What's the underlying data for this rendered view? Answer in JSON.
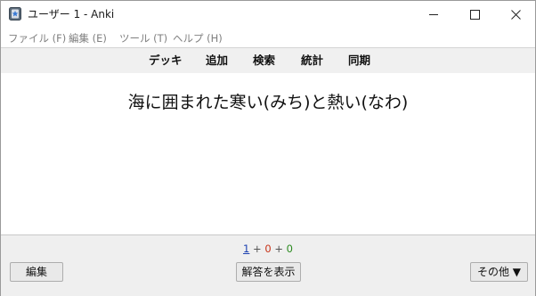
{
  "window": {
    "title": "ユーザー 1 - Anki",
    "icon": "anki-app-icon",
    "controls": [
      "minimize-icon",
      "maximize-icon",
      "close-icon"
    ]
  },
  "menu": {
    "items": [
      {
        "label": "ファイル (F)"
      },
      {
        "label": "編集 (E)"
      },
      {
        "label": "ツール (T)"
      },
      {
        "label": "ヘルプ (H)"
      }
    ]
  },
  "toolbar": {
    "items": [
      {
        "label": "デッキ"
      },
      {
        "label": "追加"
      },
      {
        "label": "検索"
      },
      {
        "label": "統計"
      },
      {
        "label": "同期"
      }
    ]
  },
  "card": {
    "question": "海に囲まれた寒い(みち)と熱い(なわ)"
  },
  "counts": {
    "new": "1",
    "learning": "0",
    "review": "0",
    "separator": "+",
    "colors": {
      "new": "#1a3fb0",
      "learning": "#c8341a",
      "review": "#2a8a1e"
    }
  },
  "buttons": {
    "edit": "編集",
    "show_answer": "解答を表示",
    "more": "その他 ▼"
  }
}
